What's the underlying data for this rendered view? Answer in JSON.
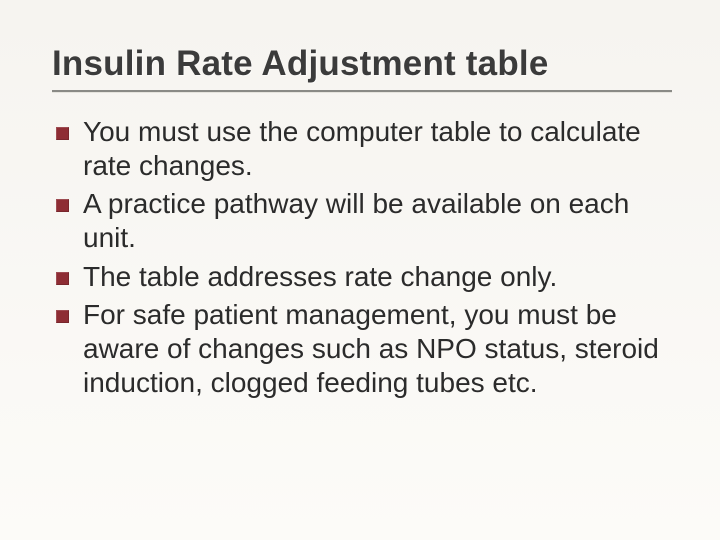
{
  "slide": {
    "title": "Insulin Rate Adjustment table",
    "bullets": [
      "You must use the computer table to calculate rate changes.",
      "A practice pathway will be available on each unit.",
      "The table addresses rate change only.",
      "For safe patient management, you must be aware of changes such as NPO status, steroid induction, clogged feeding tubes etc."
    ]
  }
}
